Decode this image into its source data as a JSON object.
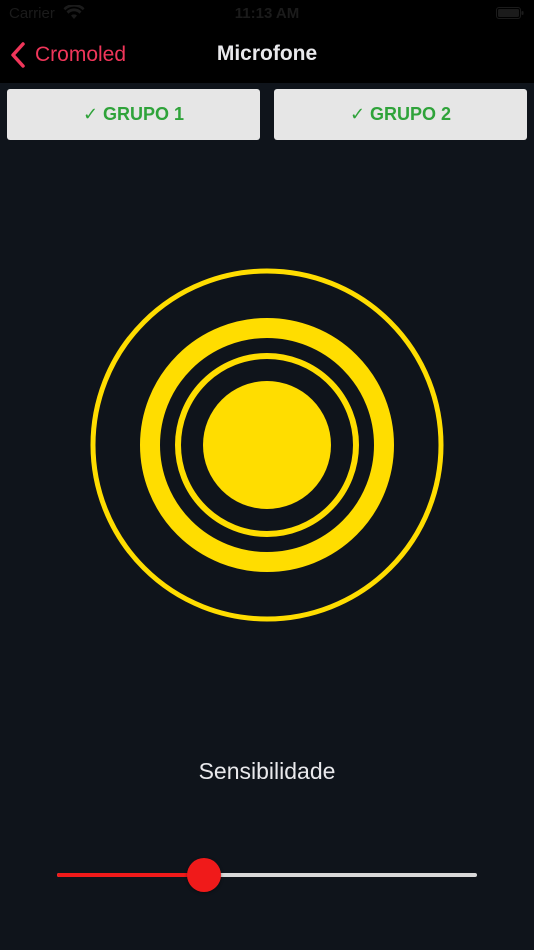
{
  "status_bar": {
    "carrier": "Carrier",
    "time": "11:13 AM"
  },
  "nav": {
    "back_label": "Cromoled",
    "title": "Microfone"
  },
  "groups": [
    {
      "check": "✓",
      "label": "GRUPO 1",
      "selected": true
    },
    {
      "check": "✓",
      "label": "GRUPO 2",
      "selected": true
    }
  ],
  "visualizer": {
    "color": "#ffdd00"
  },
  "sensitivity": {
    "label": "Sensibilidade",
    "value": 0.35
  },
  "colors": {
    "accent": "#f0365a",
    "group_check": "#2fa33a",
    "slider": "#f01a1a",
    "background": "#0f141b"
  }
}
